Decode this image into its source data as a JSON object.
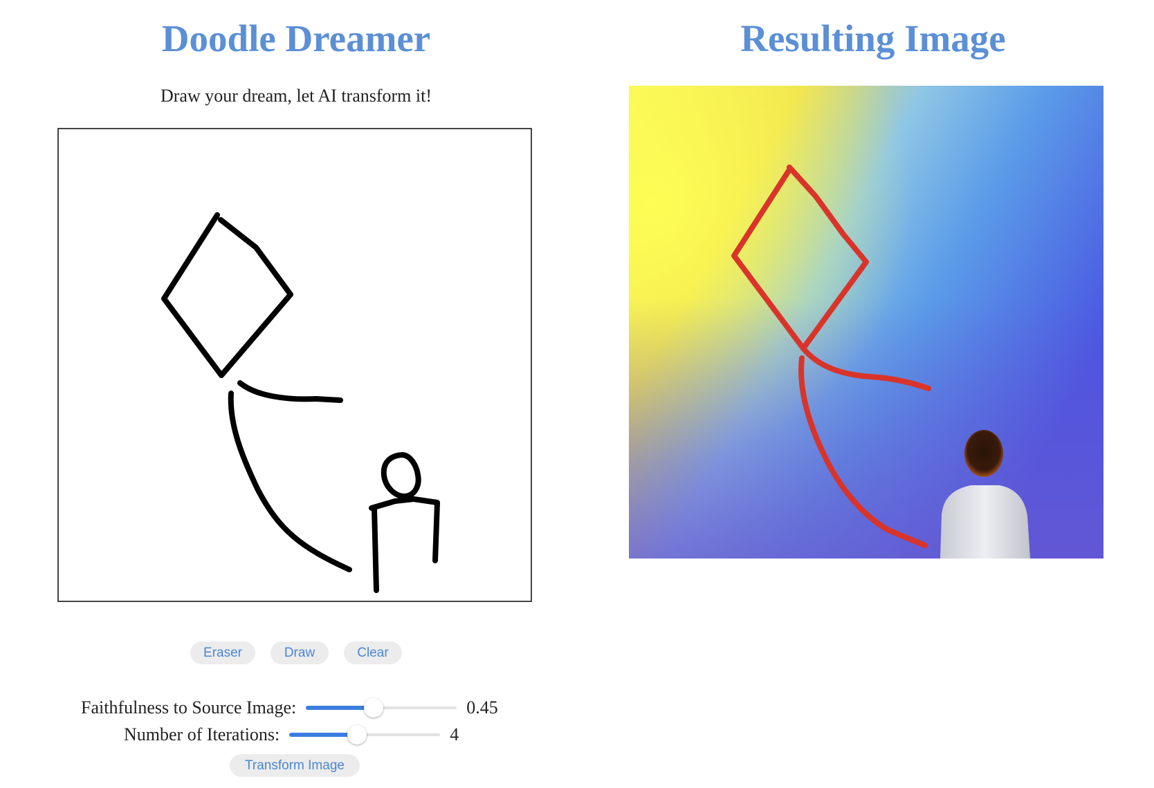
{
  "left_panel": {
    "title": "Doodle Dreamer",
    "subtitle": "Draw your dream, let AI transform it!"
  },
  "right_panel": {
    "title": "Resulting Image"
  },
  "tools": {
    "eraser_label": "Eraser",
    "draw_label": "Draw",
    "clear_label": "Clear"
  },
  "controls": {
    "faithfulness": {
      "label": "Faithfulness to Source Image:",
      "value": "0.45",
      "fraction": 0.45
    },
    "iterations": {
      "label": "Number of Iterations:",
      "value": "4",
      "fraction": 0.45
    },
    "transform_label": "Transform Image"
  },
  "colors": {
    "title_blue": "#5b8fd6",
    "button_text": "#4a86d3",
    "button_bg": "#ececec",
    "slider_fill": "#3b7de0",
    "stroke_red": "#d9342a"
  }
}
